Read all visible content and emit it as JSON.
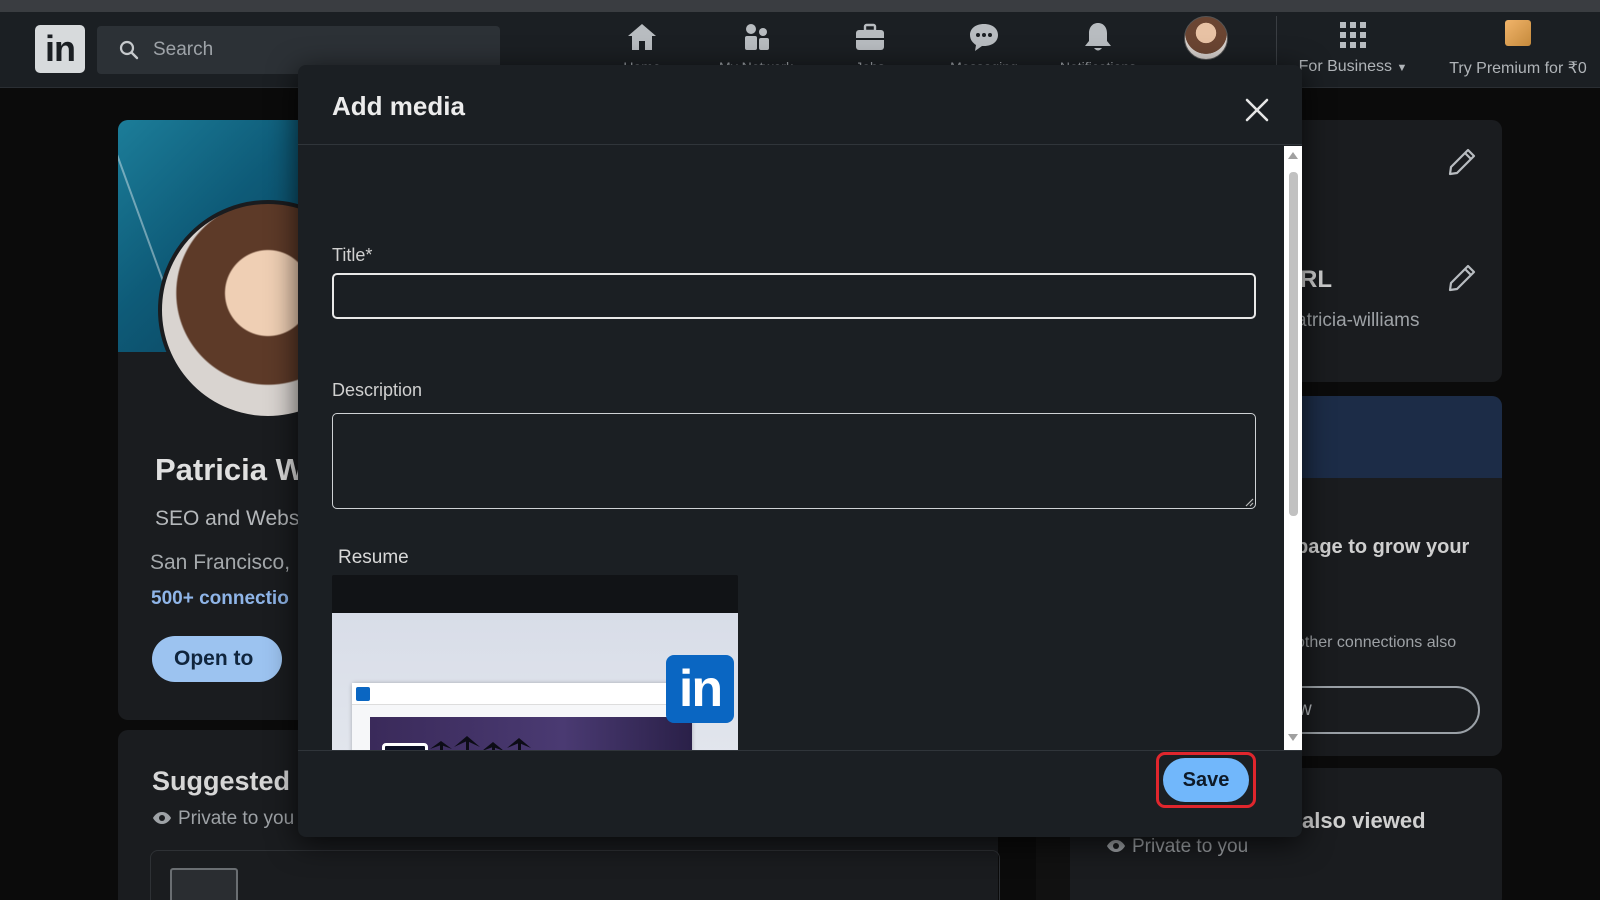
{
  "topbar": {
    "logo_text": "in",
    "search_placeholder": "Search",
    "nav": [
      {
        "label": "Home",
        "icon": "home-icon"
      },
      {
        "label": "My Network",
        "icon": "network-icon"
      },
      {
        "label": "Jobs",
        "icon": "jobs-icon"
      },
      {
        "label": "Messaging",
        "icon": "messaging-icon"
      },
      {
        "label": "Notifications",
        "icon": "bell-icon"
      },
      {
        "label": "Me",
        "icon": "avatar"
      }
    ],
    "for_business": "For Business",
    "premium": "Try Premium for ₹0"
  },
  "profile": {
    "name": "Patricia W",
    "headline": "SEO and Webs",
    "location": "San Francisco,",
    "connections": "500+ connectio",
    "open_to": "Open to"
  },
  "suggested": {
    "title": "Suggested",
    "privacy": "Private to you"
  },
  "right_rail": {
    "url_heading": "RL",
    "url_slug": "atricia-williams",
    "grow_text": "page to grow your",
    "connections_text": "other connections also",
    "button_label": "w",
    "viewed_heading": "also viewed",
    "privacy": "Private to you"
  },
  "modal": {
    "title": "Add media",
    "title_label": "Title*",
    "title_value": "",
    "description_label": "Description",
    "description_value": "",
    "resume_label": "Resume",
    "thumbnail_badge": "in",
    "save_label": "Save"
  },
  "colors": {
    "save_button": "#71b7fb",
    "highlight_ring": "#e0262d",
    "linkedin_blue": "#0a66c2",
    "modal_bg": "#1b1f23"
  }
}
